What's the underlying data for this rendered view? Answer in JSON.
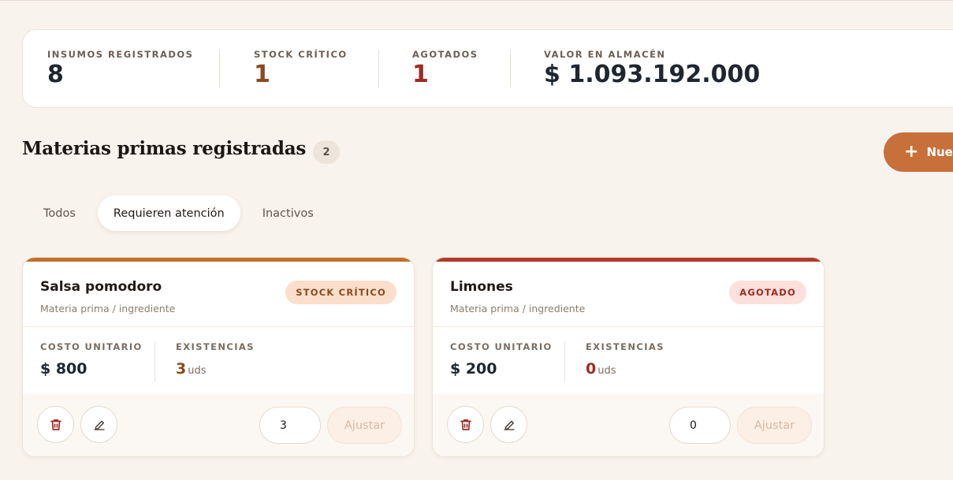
{
  "stats": [
    {
      "label": "INSUMOS REGISTRADOS",
      "value": "8",
      "tone": "normal"
    },
    {
      "label": "STOCK CRÍTICO",
      "value": "1",
      "tone": "warn"
    },
    {
      "label": "AGOTADOS",
      "value": "1",
      "tone": "danger"
    },
    {
      "label": "VALOR EN ALMACÉN",
      "value": "$ 1.093.192.000",
      "tone": "normal"
    }
  ],
  "section": {
    "title": "Materias primas registradas",
    "count": "2"
  },
  "new_button": {
    "label": "Nuevo"
  },
  "tabs": [
    {
      "label": "Todos",
      "active": false
    },
    {
      "label": "Requieren atención",
      "active": true
    },
    {
      "label": "Inactivos",
      "active": false
    }
  ],
  "cards": [
    {
      "name": "Salsa pomodoro",
      "subtitle": "Materia prima / ingrediente",
      "badge": "STOCK CRÍTICO",
      "status": "warn",
      "accent": "#c0702f",
      "cost_label": "COSTO UNITARIO",
      "cost": "$ 800",
      "stock_label": "EXISTENCIAS",
      "stock": "3",
      "stock_unit": "uds",
      "qty": "3",
      "adjust_label": "Ajustar"
    },
    {
      "name": "Limones",
      "subtitle": "Materia prima / ingrediente",
      "badge": "AGOTADO",
      "status": "danger",
      "accent": "#b23a2c",
      "cost_label": "COSTO UNITARIO",
      "cost": "$ 200",
      "stock_label": "EXISTENCIAS",
      "stock": "0",
      "stock_unit": "uds",
      "qty": "0",
      "adjust_label": "Ajustar"
    }
  ],
  "colors": {
    "background": "#f8f3ed",
    "primary": "#c8703a",
    "warn": "#8a4a1f",
    "danger": "#9c2c22"
  },
  "icons": {
    "delete": "trash-icon",
    "edit": "pencil-icon",
    "add": "plus-icon"
  }
}
